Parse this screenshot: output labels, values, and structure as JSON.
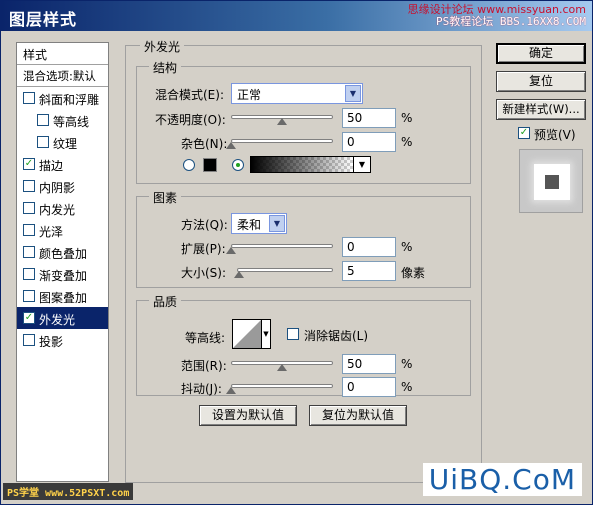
{
  "window": {
    "title": "图层样式"
  },
  "watermark_top": {
    "line1": "思缘设计论坛 www.missyuan.com",
    "line2": "PS教程论坛 BBS.16XX8.COM"
  },
  "watermark_bottom": {
    "brand": "UiBQ.CoM",
    "left": "PS学堂 www.52PSXT.com"
  },
  "stylelist": {
    "header": "样式",
    "blend_options": "混合选项:默认",
    "items": [
      {
        "label": "斜面和浮雕",
        "checked": false,
        "indent": false
      },
      {
        "label": "等高线",
        "checked": false,
        "indent": true
      },
      {
        "label": "纹理",
        "checked": false,
        "indent": true
      },
      {
        "label": "描边",
        "checked": true,
        "indent": false
      },
      {
        "label": "内阴影",
        "checked": false,
        "indent": false
      },
      {
        "label": "内发光",
        "checked": false,
        "indent": false
      },
      {
        "label": "光泽",
        "checked": false,
        "indent": false
      },
      {
        "label": "颜色叠加",
        "checked": false,
        "indent": false
      },
      {
        "label": "渐变叠加",
        "checked": false,
        "indent": false
      },
      {
        "label": "图案叠加",
        "checked": false,
        "indent": false
      },
      {
        "label": "外发光",
        "checked": true,
        "indent": false,
        "selected": true
      },
      {
        "label": "投影",
        "checked": false,
        "indent": false
      }
    ]
  },
  "outer_glow": {
    "title": "外发光",
    "structure": {
      "title": "结构",
      "blend_mode_label": "混合模式(E):",
      "blend_mode_value": "正常",
      "opacity_label": "不透明度(O):",
      "opacity_value": "50",
      "opacity_unit": "%",
      "opacity_fraction": 0.5,
      "noise_label": "杂色(N):",
      "noise_value": "0",
      "noise_unit": "%",
      "noise_fraction": 0.0,
      "color_swatch": "#000000",
      "gradient_selected": true
    },
    "elements": {
      "title": "图素",
      "technique_label": "方法(Q):",
      "technique_value": "柔和",
      "spread_label": "扩展(P):",
      "spread_value": "0",
      "spread_unit": "%",
      "spread_fraction": 0.0,
      "size_label": "大小(S):",
      "size_value": "5",
      "size_unit": "像素",
      "size_fraction": 0.02
    },
    "quality": {
      "title": "品质",
      "contour_label": "等高线:",
      "antialias_label": "消除锯齿(L)",
      "antialias_checked": false,
      "range_label": "范围(R):",
      "range_value": "50",
      "range_unit": "%",
      "range_fraction": 0.5,
      "jitter_label": "抖动(J):",
      "jitter_value": "0",
      "jitter_unit": "%",
      "jitter_fraction": 0.0
    },
    "set_default": "设置为默认值",
    "reset_default": "复位为默认值"
  },
  "buttons": {
    "ok": "确定",
    "reset": "复位",
    "new_style": "新建样式(W)...",
    "preview_label": "预览(V)",
    "preview_checked": true
  },
  "colors": {
    "accent": "#0a246a",
    "check": "#21a121",
    "brand": "#1a5fa8"
  }
}
